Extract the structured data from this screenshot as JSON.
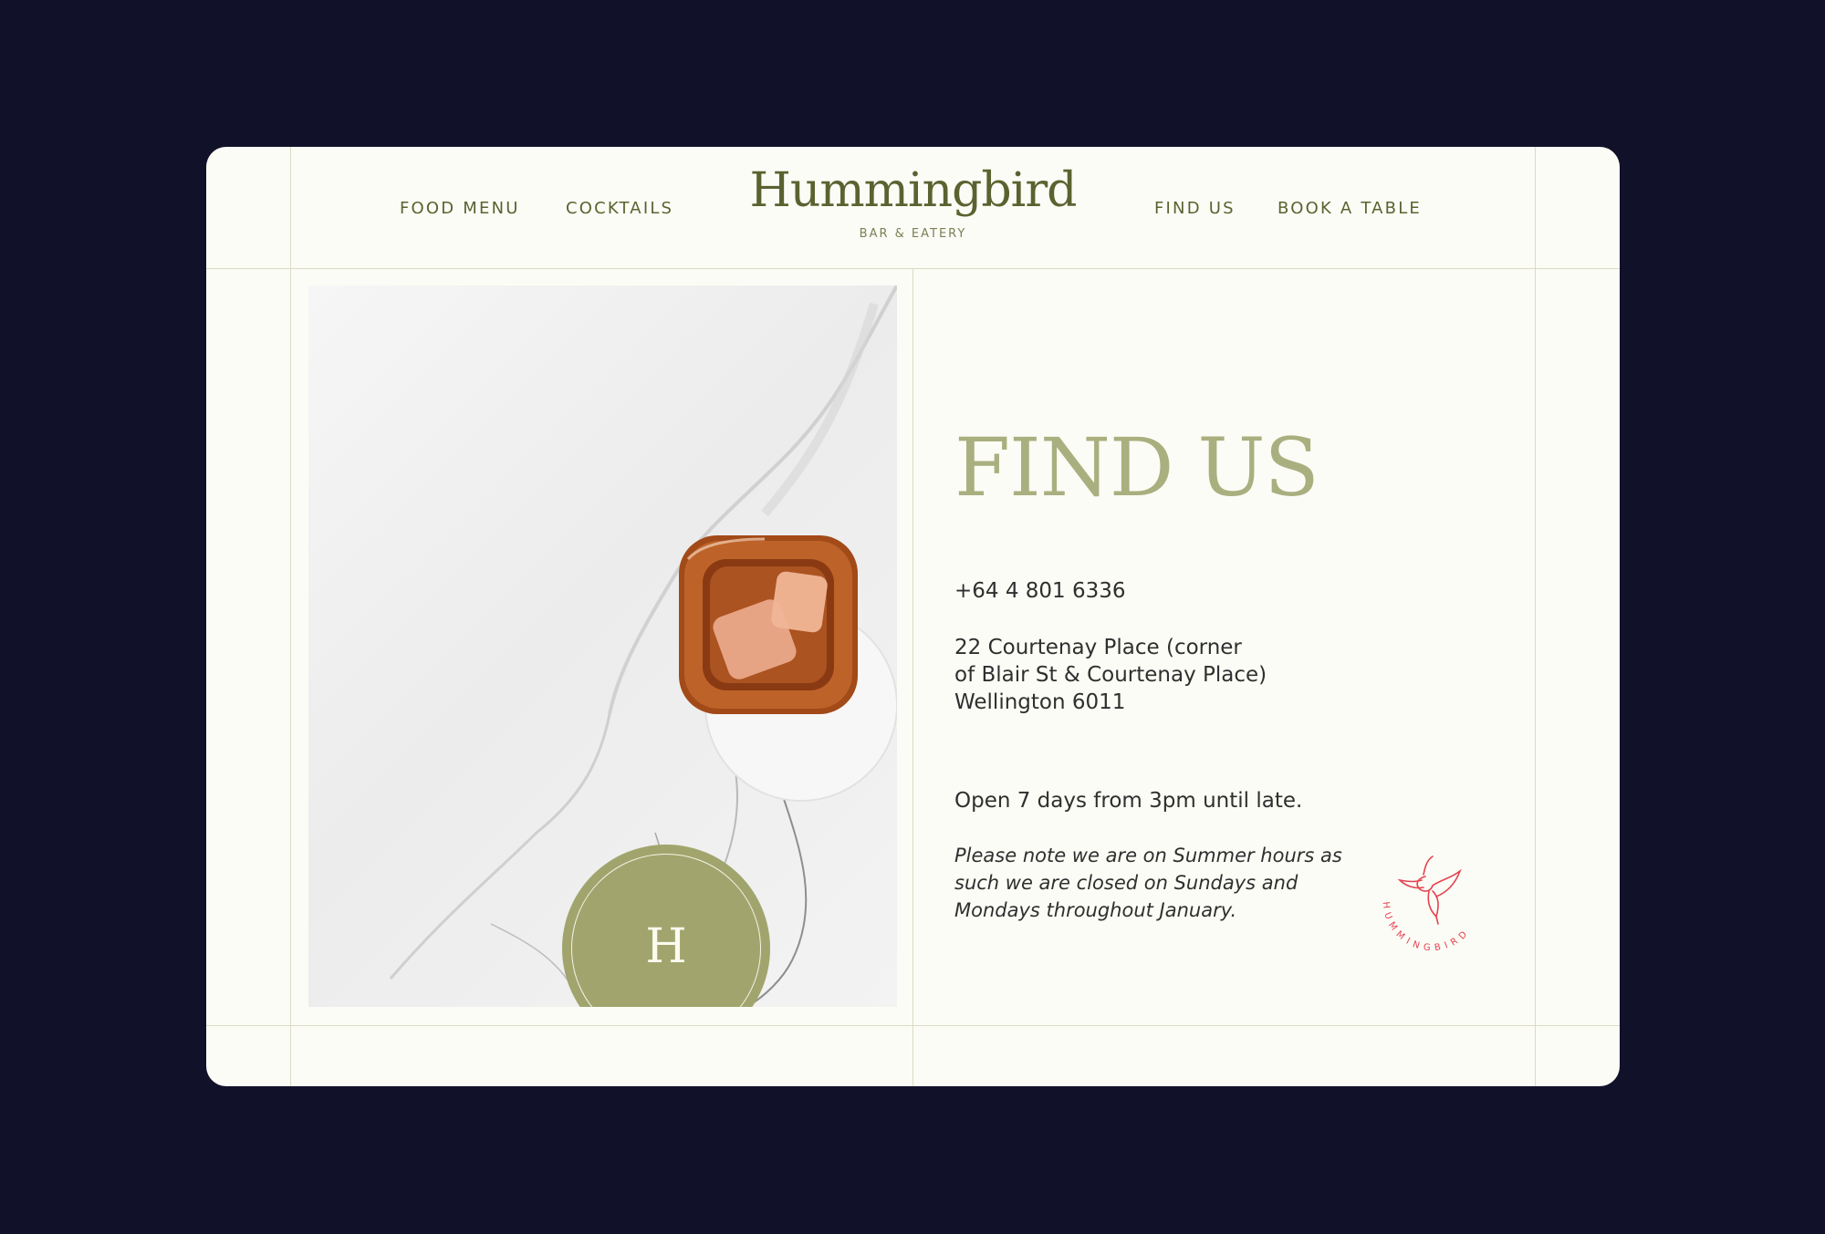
{
  "nav": {
    "left": [
      "FOOD MENU",
      "COCKTAILS"
    ],
    "right": [
      "FIND US",
      "BOOK A TABLE"
    ]
  },
  "logo": {
    "name": "Hummingbird",
    "subtitle": "BAR & EATERY"
  },
  "badge": {
    "letter": "H"
  },
  "main": {
    "heading": "FIND US",
    "phone": "+64 4 801 6336",
    "address": [
      "22 Courtenay Place (corner",
      "of Blair St & Courtenay Place)",
      "Wellington 6011"
    ],
    "hours": "Open 7 days from 3pm until late.",
    "note": [
      "Please note we are on Summer hours as",
      "such we are closed on Sundays and",
      "Mondays throughout January."
    ]
  },
  "emblem": {
    "text": "HUMMINGBIRD",
    "icon": "hummingbird-icon"
  },
  "colors": {
    "background": "#12112a",
    "card": "#fcfcf6",
    "olive": "#5b6230",
    "sage": "#a1a56d",
    "accent_red": "#e5424f"
  }
}
